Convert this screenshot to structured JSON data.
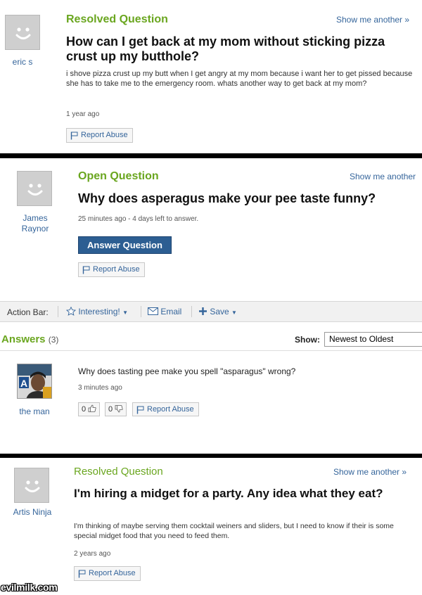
{
  "question1": {
    "user": "eric s",
    "status": "Resolved Question",
    "show_more": "Show me another »",
    "title": "How can I get back at my mom without sticking pizza crust up my butthole?",
    "body": "i shove pizza crust up my butt when I get angry at my mom because i want her to get pissed because she has to take me to the emergency room. whats another way to get back at my mom?",
    "time": "1 year ago",
    "report": "Report Abuse"
  },
  "question2": {
    "user_line1": "James",
    "user_line2": "Raynor",
    "status": "Open Question",
    "show_more": "Show me another",
    "title": "Why does asperagus make your pee taste funny?",
    "time": "25 minutes ago - 4 days left to answer.",
    "answer_button": "Answer Question",
    "report": "Report Abuse",
    "action_bar": {
      "label": "Action Bar:",
      "interesting": "Interesting!",
      "email": "Email",
      "save": "Save"
    },
    "answers": {
      "heading": "Answers",
      "count": "(3)",
      "show_label": "Show:",
      "sort_selected": "Newest to Oldest",
      "items": [
        {
          "user": "the man",
          "text": "Why does tasting pee make you spell \"asparagus\" wrong?",
          "time": "3 minutes ago",
          "thumbs_up": "0",
          "thumbs_down": "0",
          "report": "Report Abuse"
        }
      ]
    }
  },
  "question3": {
    "user": "Artis Ninja",
    "status": "Resolved Question",
    "show_more": "Show me another »",
    "title": "I'm hiring a midget for a party. Any idea what they eat?",
    "body": "I'm thinking of maybe serving them cocktail weiners and sliders, but I need to know if their is some special midget food that you need to feed them.",
    "time": "2 years ago",
    "report": "Report Abuse"
  },
  "watermark": "evilmilk.com",
  "colors": {
    "status_green": "#6aa61f",
    "link_blue": "#35659b",
    "button_blue": "#2c5e92"
  }
}
